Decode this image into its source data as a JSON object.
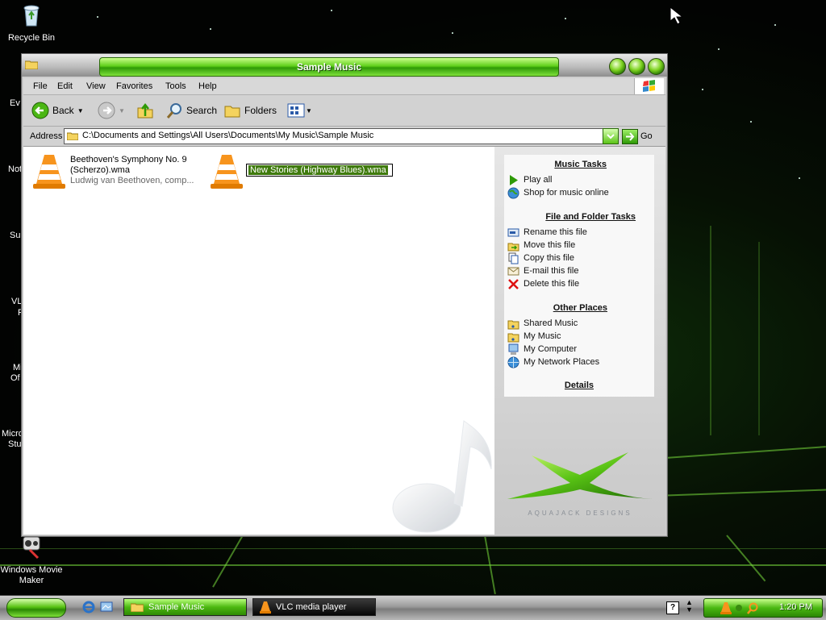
{
  "desktop": {
    "icons": {
      "recycle_bin": "Recycle Bin",
      "windows_movie_maker_line1": "Windows Movie",
      "windows_movie_maker_line2": "Maker"
    },
    "partial_labels": [
      "Ev",
      "Not",
      "Su",
      "VL",
      "P",
      "Mi",
      "Of",
      "Micro",
      "Stu"
    ]
  },
  "window": {
    "title": "Sample Music",
    "menu": [
      "File",
      "Edit",
      "View",
      "Favorites",
      "Tools",
      "Help"
    ],
    "toolbar": {
      "back_label": "Back",
      "search_label": "Search",
      "folders_label": "Folders"
    },
    "address": {
      "label": "Address",
      "path": "C:\\Documents and Settings\\All Users\\Documents\\My Music\\Sample Music",
      "go_label": "Go"
    },
    "files": [
      {
        "name": "Beethoven's Symphony No. 9 (Scherzo).wma",
        "artist": "Ludwig van Beethoven, comp..."
      },
      {
        "rename_value": "New Stories (Highway Blues).wma"
      }
    ],
    "task_pane": {
      "music_tasks": {
        "title": "Music Tasks",
        "items": [
          "Play all",
          "Shop for music online"
        ]
      },
      "file_folder_tasks": {
        "title": "File and Folder Tasks",
        "items": [
          "Rename this file",
          "Move this file",
          "Copy this file",
          "E-mail this file",
          "Delete this file"
        ]
      },
      "other_places": {
        "title": "Other Places",
        "items": [
          "Shared Music",
          "My Music",
          "My Computer",
          "My Network Places"
        ]
      },
      "details": {
        "title": "Details"
      },
      "brand_text": "AQUAJACK DESIGNS"
    }
  },
  "taskbar": {
    "buttons": [
      "Sample Music",
      "VLC media player"
    ],
    "clock": "1:20 PM",
    "help_glyph": "?"
  },
  "colors": {
    "accent_green": "#4cb811",
    "title_text": "#ffffff",
    "rename_highlight": "#3f7a0d"
  }
}
